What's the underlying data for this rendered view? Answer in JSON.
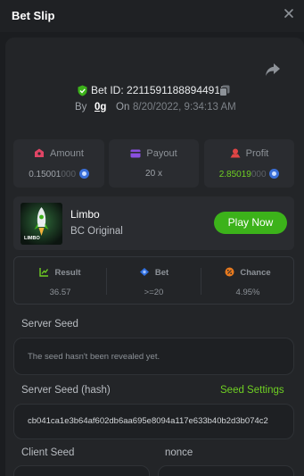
{
  "header": {
    "title": "Bet Slip"
  },
  "bet": {
    "id_label": "Bet ID: 2211591188894491​8",
    "by_label": "By",
    "user": "0g",
    "on_label": "On",
    "date": "8/20/2022, 9:34:13 AM"
  },
  "stats": {
    "amount": {
      "label": "Amount",
      "value_main": "0.15001",
      "value_dim": "000"
    },
    "payout": {
      "label": "Payout",
      "value": "20 x"
    },
    "profit": {
      "label": "Profit",
      "value_main": "2.85019",
      "value_dim": "000"
    }
  },
  "game": {
    "name": "Limbo",
    "provider": "BC Original",
    "play_label": "Play Now",
    "thumb_text": "LIMBO"
  },
  "results": {
    "result": {
      "label": "Result",
      "value": "36.57"
    },
    "bet": {
      "label": "Bet",
      "value": ">=20"
    },
    "chance": {
      "label": "Chance",
      "value": "4.95%"
    }
  },
  "server_seed": {
    "label": "Server Seed",
    "value": "The seed hasn't been revealed yet."
  },
  "server_seed_hash": {
    "label": "Server Seed (hash)",
    "settings_link": "Seed Settings",
    "value": "cb041ca1e3b64af602db6aa695e8094a117e633b40b2d3b074c2"
  },
  "client_seed": {
    "label": "Client Seed"
  },
  "nonce": {
    "label": "nonce"
  },
  "colors": {
    "accent": "#3cb21a",
    "profit": "#6fcf23",
    "background": "#1b1d20"
  }
}
